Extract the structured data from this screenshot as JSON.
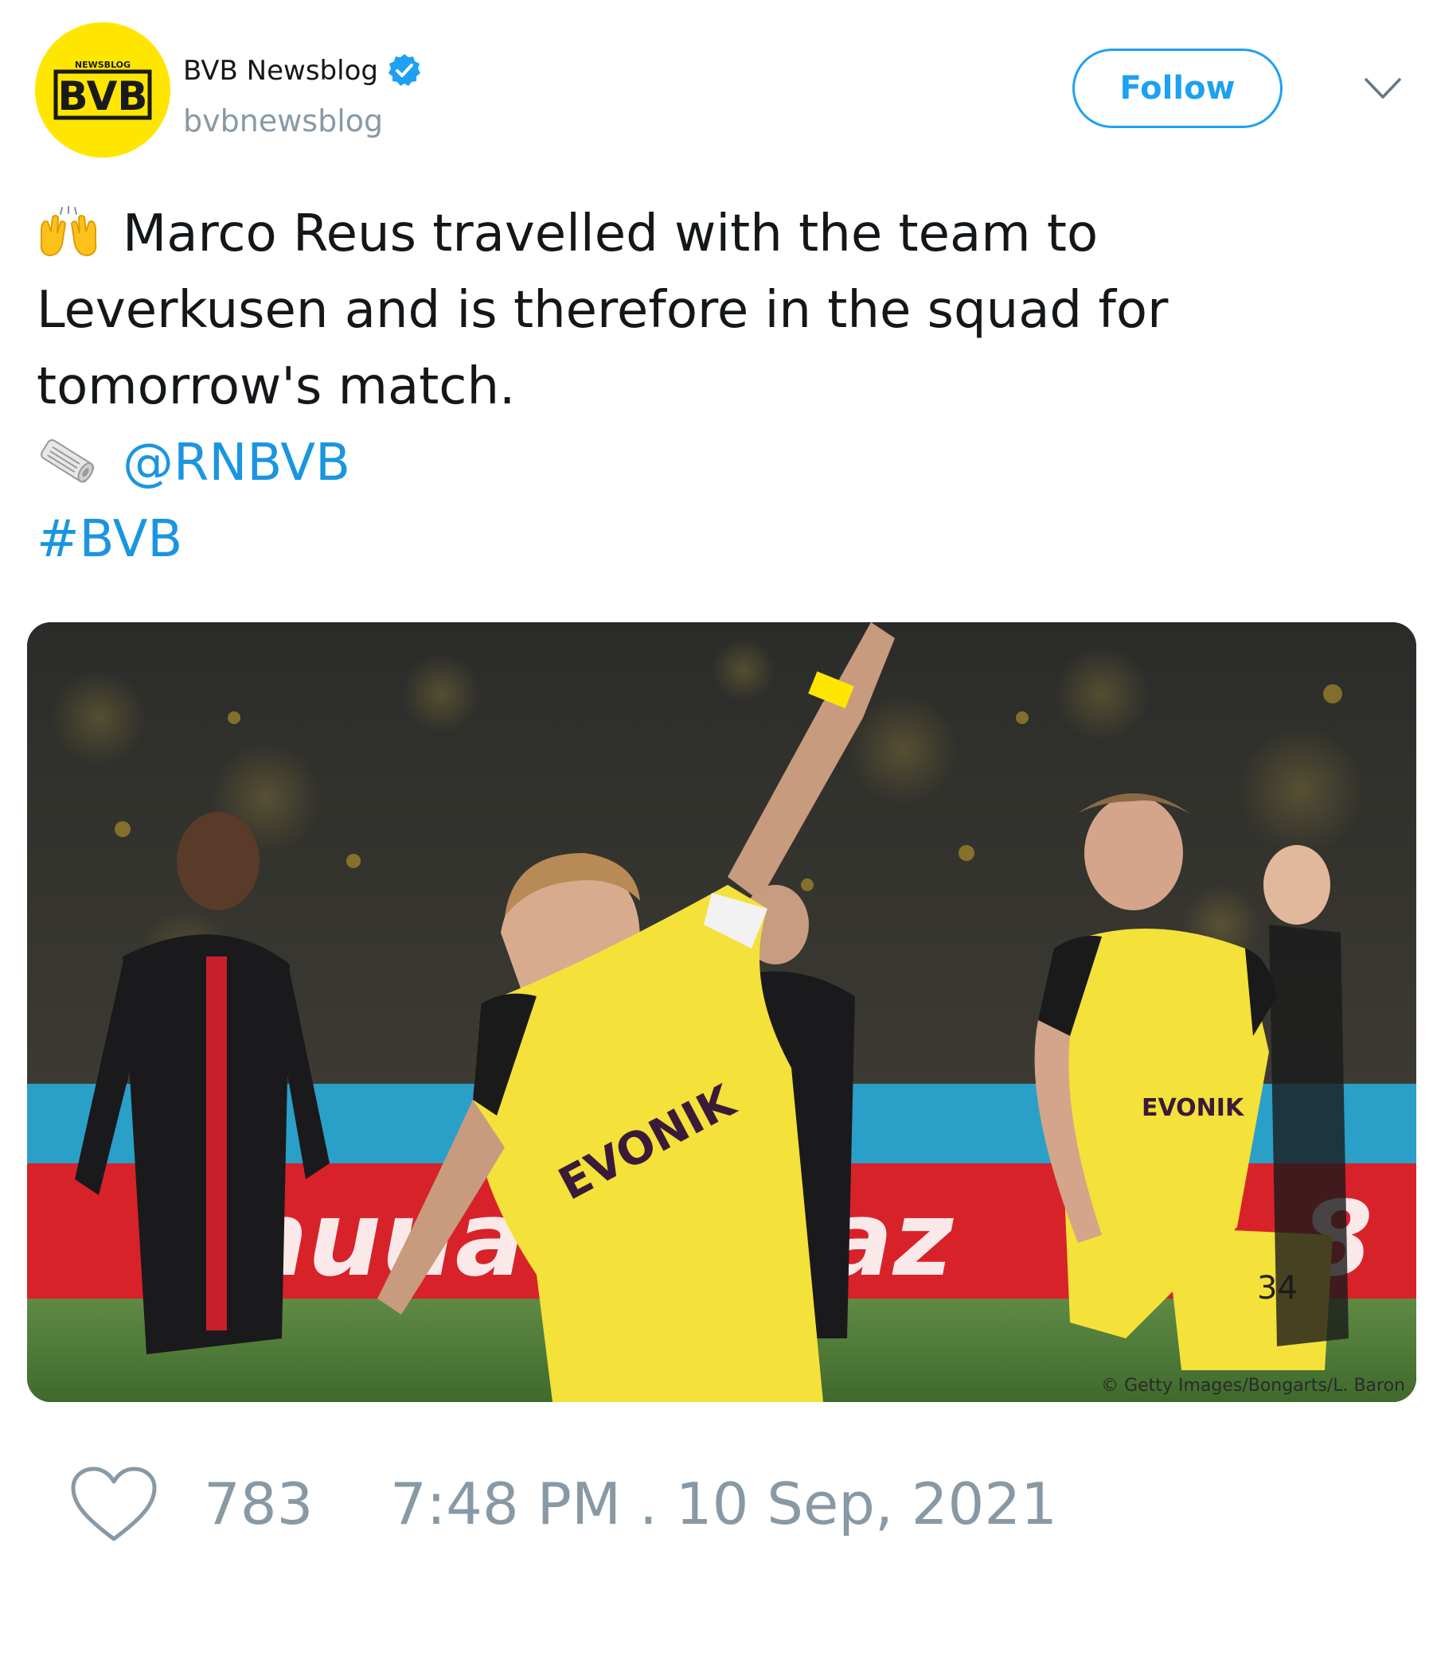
{
  "author": {
    "display_name": "BVB Newsblog",
    "handle": "bvbnewsblog",
    "avatar_text": "BVB",
    "avatar_small_text": "NEWSBLOG",
    "verified": true
  },
  "header": {
    "follow_label": "Follow",
    "menu_icon": "chevron-down-icon"
  },
  "tweet": {
    "line1": "Marco Reus travelled with the team to",
    "line2": "Leverkusen and is therefore in the squad for",
    "line3": "tomorrow's match.",
    "emoji_1": "raising-hands-emoji",
    "emoji_2": "rolled-newspaper-emoji",
    "mention": "@RNBVB",
    "hashtag": "#BVB"
  },
  "media": {
    "credit": "© Getty Images/Bongarts/L. Baron",
    "shirt_number": "34",
    "sponsor": "EVONIK"
  },
  "footer": {
    "like_icon": "heart-icon",
    "like_count": "783",
    "timestamp": "7:48 PM . 10 Sep, 2021"
  },
  "colors": {
    "accent": "#1da1f2",
    "link": "#1b95e0",
    "muted": "#8899a6",
    "bvb_yellow": "#ffe600"
  }
}
